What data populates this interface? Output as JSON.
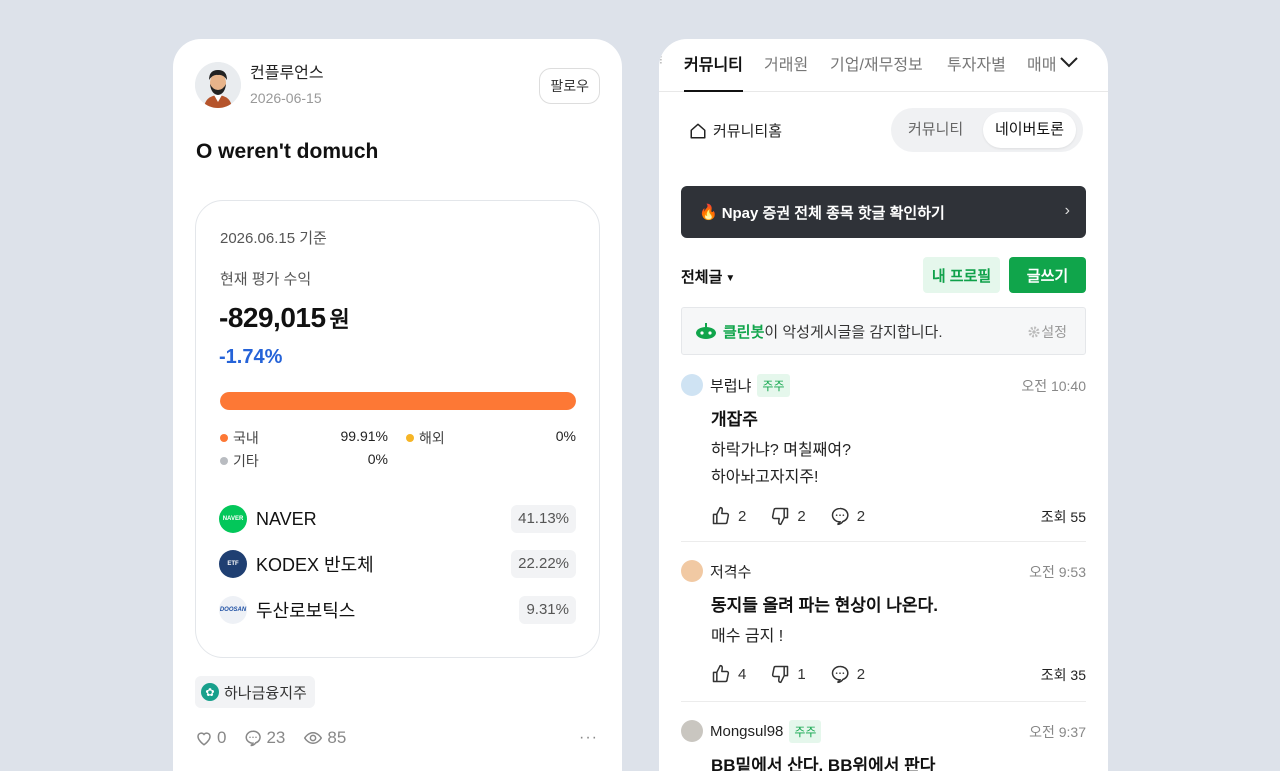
{
  "left": {
    "author_name": "컨플루언스",
    "author_date": "2026-06-15",
    "follow_label": "팔로우",
    "post_title": "O weren't domuch",
    "portfolio": {
      "as_of": "2026.06.15 기준",
      "label": "현재 평가 수익",
      "amount": "-829,015",
      "unit": "원",
      "rate": "-1.74%",
      "domestic_share": 99.91,
      "legend": [
        {
          "label": "국내",
          "value": "99.91%",
          "color": "#fd7835"
        },
        {
          "label": "해외",
          "value": "0%",
          "color": "#f6b526"
        },
        {
          "label": "기타",
          "value": "0%",
          "color": "#b9bcc1"
        }
      ],
      "holdings": [
        {
          "name": "NAVER",
          "pct": "41.13%",
          "logo": "NAVER",
          "logo_color": "#03c75a"
        },
        {
          "name": "KODEX 반도체",
          "pct": "22.22%",
          "logo": "ETF",
          "logo_color": "#1f3f72"
        },
        {
          "name": "두산로보틱스",
          "pct": "9.31%",
          "logo": "DOOSAN",
          "logo_color": "#eef1f6"
        }
      ]
    },
    "tag": "하나금융지주",
    "stats": {
      "likes": "0",
      "comments": "23",
      "views": "85"
    }
  },
  "right": {
    "tabs": [
      "커뮤니티",
      "거래원",
      "기업/재무정보",
      "투자자별",
      "매매"
    ],
    "home_link": "커뮤니티홈",
    "segments": [
      "커뮤니티",
      "네이버토론"
    ],
    "banner": "Npay 증권 전체 종목 핫글 확인하기",
    "filter": "전체글",
    "profile_button": "내 프로필",
    "write_button": "글쓰기",
    "cleanbot": {
      "name": "클린봇",
      "text": "이 악성게시글을 감지합니다.",
      "settings": "설정"
    },
    "posts": [
      {
        "user": "부럽냐",
        "badge": "주주",
        "time": "오전 10:40",
        "title": "개잡주",
        "lines": [
          "하락가냐? 며칠째여?",
          "하아놔고자지주!"
        ],
        "likes": "2",
        "dislikes": "2",
        "comments": "2",
        "views": "조회 55"
      },
      {
        "user": "저격수",
        "badge": "",
        "time": "오전 9:53",
        "title": "동지들 올려 파는 현상이 나온다.",
        "lines": [
          "매수 금지 !"
        ],
        "likes": "4",
        "dislikes": "1",
        "comments": "2",
        "views": "조회 35"
      },
      {
        "user": "Mongsul98",
        "badge": "주주",
        "time": "오전 9:37",
        "title": "BB밑에서 산다. BB위에서 판다",
        "lines": [],
        "likes": "",
        "dislikes": "",
        "comments": "",
        "views": ""
      }
    ]
  }
}
